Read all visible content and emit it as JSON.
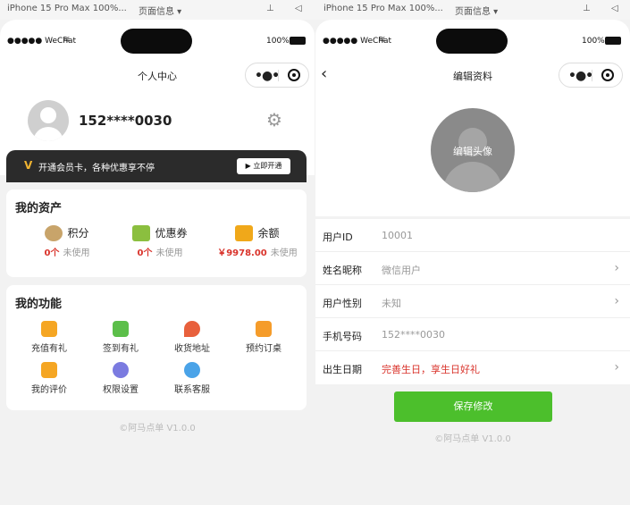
{
  "topbar": {
    "device_left": "iPhone 15 Pro Max 100%...",
    "page_info_left": "页面信息 ▾",
    "device_right": "iPhone 15 Pro Max 100%...",
    "page_info_right": "页面信息 ▾"
  },
  "status": {
    "carrier": "●●●●● WeChat",
    "battery": "100%"
  },
  "left": {
    "nav_title": "个人中心",
    "user": {
      "phone": "152****0030"
    },
    "vip": {
      "badge": "V",
      "text": "开通会员卡，各种优惠享不停",
      "button": "立即开通"
    },
    "assets": {
      "title": "我的资产",
      "items": [
        {
          "label": "积分",
          "value": "0个",
          "unit": "未使用",
          "color": "#c8a46a"
        },
        {
          "label": "优惠券",
          "value": "0个",
          "unit": "未使用",
          "color": "#8bbf3f"
        },
        {
          "label": "余额",
          "value": "￥9978.00",
          "unit": "未使用",
          "color": "#f0a81a"
        }
      ]
    },
    "functions": {
      "title": "我的功能",
      "items": [
        {
          "label": "充值有礼",
          "color": "#f5a623"
        },
        {
          "label": "签到有礼",
          "color": "#5cbf4a"
        },
        {
          "label": "收货地址",
          "color": "#e8603c"
        },
        {
          "label": "预约订桌",
          "color": "#f59c2a"
        },
        {
          "label": "我的评价",
          "color": "#f5a623"
        },
        {
          "label": "权限设置",
          "color": "#7b7be0"
        },
        {
          "label": "联系客服",
          "color": "#4aa3e8"
        }
      ]
    },
    "footer": "©阿马点单 V1.0.0"
  },
  "right": {
    "nav_title": "编辑资料",
    "avatar_label": "编辑头像",
    "rows": [
      {
        "key": "用户ID",
        "value": "10001",
        "arrow": false
      },
      {
        "key": "姓名昵称",
        "value": "微信用户",
        "arrow": true
      },
      {
        "key": "用户性别",
        "value": "未知",
        "arrow": true
      },
      {
        "key": "手机号码",
        "value": "152****0030",
        "arrow": false
      },
      {
        "key": "出生日期",
        "value": "完善生日，享生日好礼",
        "arrow": true,
        "highlight": "#d9332b"
      }
    ],
    "save_button": "保存修改",
    "footer": "©阿马点单 V1.0.0",
    "accent": "#4cbf2c"
  }
}
